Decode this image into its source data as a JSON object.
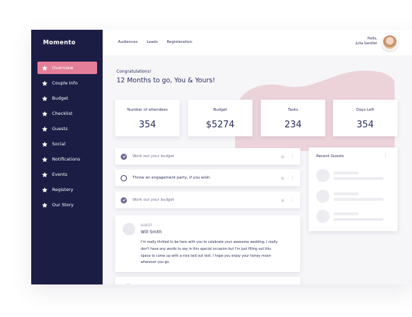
{
  "app": {
    "brand": "Momento"
  },
  "sidebar": {
    "items": [
      {
        "label": "Overview",
        "icon": "star-icon",
        "active": true
      },
      {
        "label": "Couple Info",
        "icon": "star-icon"
      },
      {
        "label": "Budget",
        "icon": "star-icon"
      },
      {
        "label": "Checklist",
        "icon": "star-icon"
      },
      {
        "label": "Guests",
        "icon": "star-icon"
      },
      {
        "label": "Social",
        "icon": "star-icon"
      },
      {
        "label": "Notifications",
        "icon": "star-icon"
      },
      {
        "label": "Events",
        "icon": "star-icon"
      },
      {
        "label": "Registery",
        "icon": "star-icon"
      },
      {
        "label": "Our Story",
        "icon": "star-icon"
      }
    ]
  },
  "topbar": {
    "nav": [
      "Audiences",
      "Leads",
      "Registeration"
    ],
    "greeting": "Hello,",
    "user_name": "Julia Sandler"
  },
  "main": {
    "congrats": "Congratulations!",
    "headline": "12 Months to go, You & Yours!",
    "stats": [
      {
        "label": "Number of attendees",
        "value": "354"
      },
      {
        "label": "Budget",
        "value": "$5274"
      },
      {
        "label": "Tasks",
        "value": "234"
      },
      {
        "label": "Days Left",
        "value": "354"
      }
    ],
    "tasks": [
      {
        "text": "Work out your budget",
        "done": true
      },
      {
        "text": "Throw an engagement party, if you wish.",
        "done": false
      },
      {
        "text": "Work out your budget",
        "done": true
      }
    ],
    "guest_post": {
      "tag": "GUEST",
      "name": "Will Smith",
      "message": "I'm really thrilled to be here with you to celebrate your awesome wedding. I really don't have any words to say in this special occasion but I'm just filling out this space to come up with a nice laid out text. I hope you enjoy your honey moon wherever you go."
    },
    "recent_guests": {
      "title": "Recent Guests"
    }
  },
  "colors": {
    "sidebar_bg": "#1b1d45",
    "accent": "#e57f99",
    "text": "#2a2d5c",
    "blob": "#ecd3da"
  }
}
